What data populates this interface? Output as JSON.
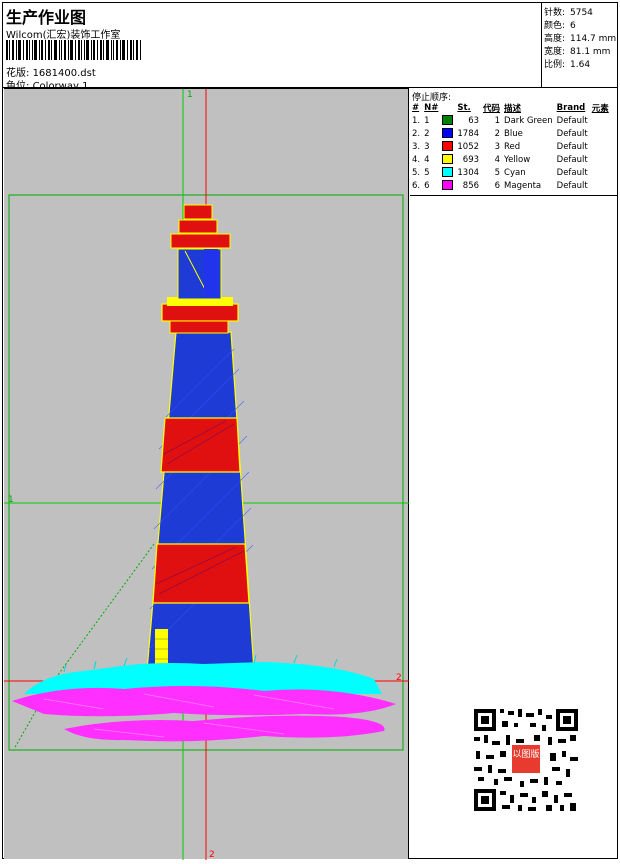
{
  "header": {
    "title": "生产作业图",
    "company": "Wilcom(汇宏)装饰工作室",
    "design_label": "花版:",
    "design_file": "1681400.dst",
    "colorway_label": "色位:",
    "colorway": "Colorway 1"
  },
  "stats": [
    {
      "label": "针数:",
      "value": "5754"
    },
    {
      "label": "颜色:",
      "value": "6"
    },
    {
      "label": "高度:",
      "value": "114.7 mm"
    },
    {
      "label": "宽度:",
      "value": "81.1 mm"
    },
    {
      "label": "比例:",
      "value": "1.64"
    }
  ],
  "sequence": {
    "title": "停止顺序:",
    "headers": [
      "#",
      "N#",
      "St.",
      "代码",
      "描述",
      "Brand",
      "元素"
    ],
    "rows": [
      {
        "idx": "1.",
        "n": "1",
        "color": "#008000",
        "st": "63",
        "code": "1",
        "desc": "Dark Green",
        "brand": "Default"
      },
      {
        "idx": "2.",
        "n": "2",
        "color": "#0000ff",
        "st": "1784",
        "code": "2",
        "desc": "Blue",
        "brand": "Default"
      },
      {
        "idx": "3.",
        "n": "3",
        "color": "#ff0000",
        "st": "1052",
        "code": "3",
        "desc": "Red",
        "brand": "Default"
      },
      {
        "idx": "4.",
        "n": "4",
        "color": "#ffff00",
        "st": "693",
        "code": "4",
        "desc": "Yellow",
        "brand": "Default"
      },
      {
        "idx": "5.",
        "n": "5",
        "color": "#00ffff",
        "st": "1304",
        "code": "5",
        "desc": "Cyan",
        "brand": "Default"
      },
      {
        "idx": "6.",
        "n": "6",
        "color": "#ff00ff",
        "st": "856",
        "code": "6",
        "desc": "Magenta",
        "brand": "Default"
      }
    ]
  },
  "axes": {
    "green_label": "1",
    "red_label": "2"
  },
  "qr_stamp": "以图版",
  "colors": {
    "canvas": "#c0c0c0",
    "guide_green": "#00cc00",
    "guide_red": "#ff0000"
  }
}
